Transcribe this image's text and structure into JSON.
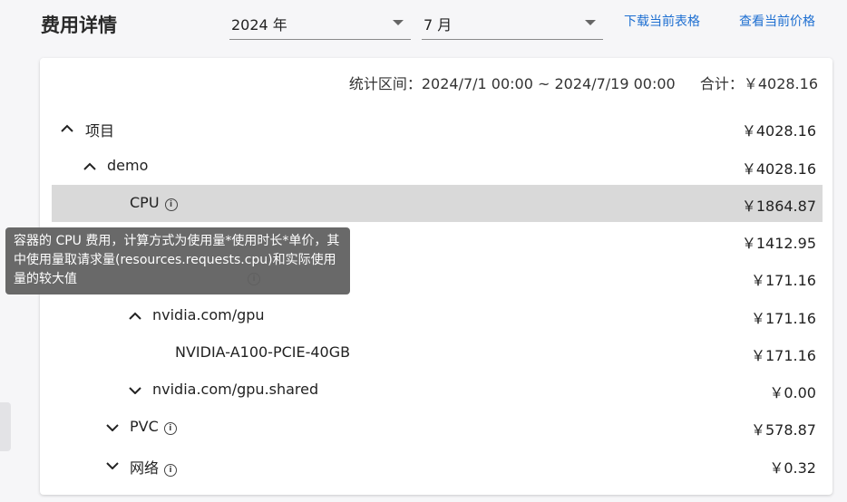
{
  "header": {
    "title": "费用详情",
    "year_select": "2024 年",
    "month_select": "7 月",
    "download_link": "下载当前表格",
    "price_link": "查看当前价格"
  },
  "summary": {
    "range": "统计区间：2024/7/1 00:00 ~ 2024/7/19 00:00",
    "total": "合计：￥4028.16"
  },
  "rows": [
    {
      "label": "项目",
      "amount": "￥4028.16",
      "expanded": true
    },
    {
      "label": "demo",
      "amount": "￥4028.16",
      "expanded": true
    },
    {
      "label": "CPU",
      "amount": "￥1864.87",
      "info": true
    },
    {
      "label": "",
      "amount": "￥1412.95"
    },
    {
      "label": "",
      "amount": "￥171.16",
      "info": true
    },
    {
      "label": "nvidia.com/gpu",
      "amount": "￥171.16",
      "expanded": true
    },
    {
      "label": "NVIDIA-A100-PCIE-40GB",
      "amount": "￥171.16"
    },
    {
      "label": "nvidia.com/gpu.shared",
      "amount": "￥0.00",
      "expanded": false
    },
    {
      "label": "PVC",
      "amount": "￥578.87",
      "expanded": false,
      "info": true
    },
    {
      "label": "网络",
      "amount": "￥0.32",
      "expanded": false,
      "info": true
    }
  ],
  "tooltip": {
    "text": "容器的 CPU 费用，计算方式为使用量*使用时长*单价，其中使用量取请求量(resources.requests.cpu)和实际使用量的较大值"
  },
  "colors": {
    "link": "#1e6fd1",
    "highlight": "#d9d9d9",
    "tooltip_bg": "#616161"
  },
  "icons": {
    "expand": "chevron-up-icon",
    "collapse": "chevron-down-icon",
    "info": "info-icon"
  }
}
